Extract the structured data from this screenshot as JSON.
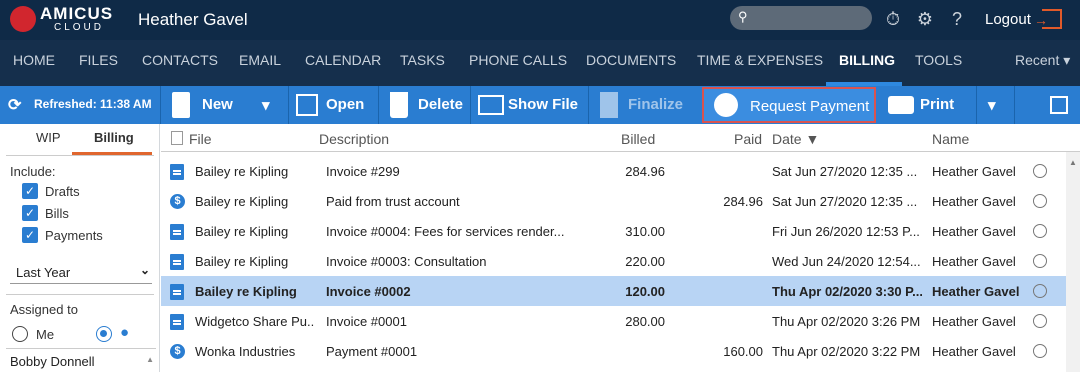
{
  "header": {
    "brand": "AMICUS",
    "brand_sub": "CLOUD",
    "user": "Heather Gavel",
    "logout": "Logout"
  },
  "nav": {
    "items": [
      "HOME",
      "FILES",
      "CONTACTS",
      "EMAIL",
      "CALENDAR",
      "TASKS",
      "PHONE CALLS",
      "DOCUMENTS",
      "TIME & EXPENSES",
      "BILLING",
      "TOOLS"
    ],
    "active": "BILLING",
    "recent": "Recent"
  },
  "toolbar": {
    "refreshed": "Refreshed: 11:38 AM",
    "new": "New",
    "open": "Open",
    "delete": "Delete",
    "show_file": "Show File",
    "finalize": "Finalize",
    "request_payment": "Request Payment",
    "print": "Print"
  },
  "left": {
    "tabs": [
      "WIP",
      "Billing"
    ],
    "include": "Include:",
    "drafts": "Drafts",
    "bills": "Bills",
    "payments": "Payments",
    "period": "Last Year",
    "assigned_to": "Assigned to",
    "me": "Me",
    "person": "Bobby Donnell"
  },
  "table": {
    "headers": {
      "file": "File",
      "description": "Description",
      "billed": "Billed",
      "paid": "Paid",
      "date": "Date",
      "name": "Name"
    },
    "rows": [
      {
        "type": "invoice",
        "file": "Bailey re Kipling",
        "description": "Invoice #299",
        "billed": "284.96",
        "paid": "",
        "date": "Sat Jun 27/2020 12:35 ...",
        "name": "Heather Gavel"
      },
      {
        "type": "payment",
        "file": "Bailey re Kipling",
        "description": "Paid from trust account",
        "billed": "",
        "paid": "284.96",
        "date": "Sat Jun 27/2020 12:35 ...",
        "name": "Heather Gavel"
      },
      {
        "type": "invoice",
        "file": "Bailey re Kipling",
        "description": "Invoice #0004: Fees for services render...",
        "billed": "310.00",
        "paid": "",
        "date": "Fri Jun 26/2020 12:53 P...",
        "name": "Heather Gavel"
      },
      {
        "type": "invoice",
        "file": "Bailey re Kipling",
        "description": "Invoice #0003: Consultation",
        "billed": "220.00",
        "paid": "",
        "date": "Wed Jun 24/2020 12:54...",
        "name": "Heather Gavel"
      },
      {
        "type": "invoice",
        "file": "Bailey re Kipling",
        "description": "Invoice #0002",
        "billed": "120.00",
        "paid": "",
        "date": "Thu Apr 02/2020 3:30 P...",
        "name": "Heather Gavel",
        "selected": true
      },
      {
        "type": "invoice",
        "file": "Widgetco Share Pu...",
        "description": "Invoice #0001",
        "billed": "280.00",
        "paid": "",
        "date": "Thu Apr 02/2020 3:26 PM",
        "name": "Heather Gavel"
      },
      {
        "type": "payment",
        "file": "Wonka Industries",
        "description": "Payment #0001",
        "billed": "",
        "paid": "160.00",
        "date": "Thu Apr 02/2020 3:22 PM",
        "name": "Heather Gavel"
      }
    ]
  }
}
